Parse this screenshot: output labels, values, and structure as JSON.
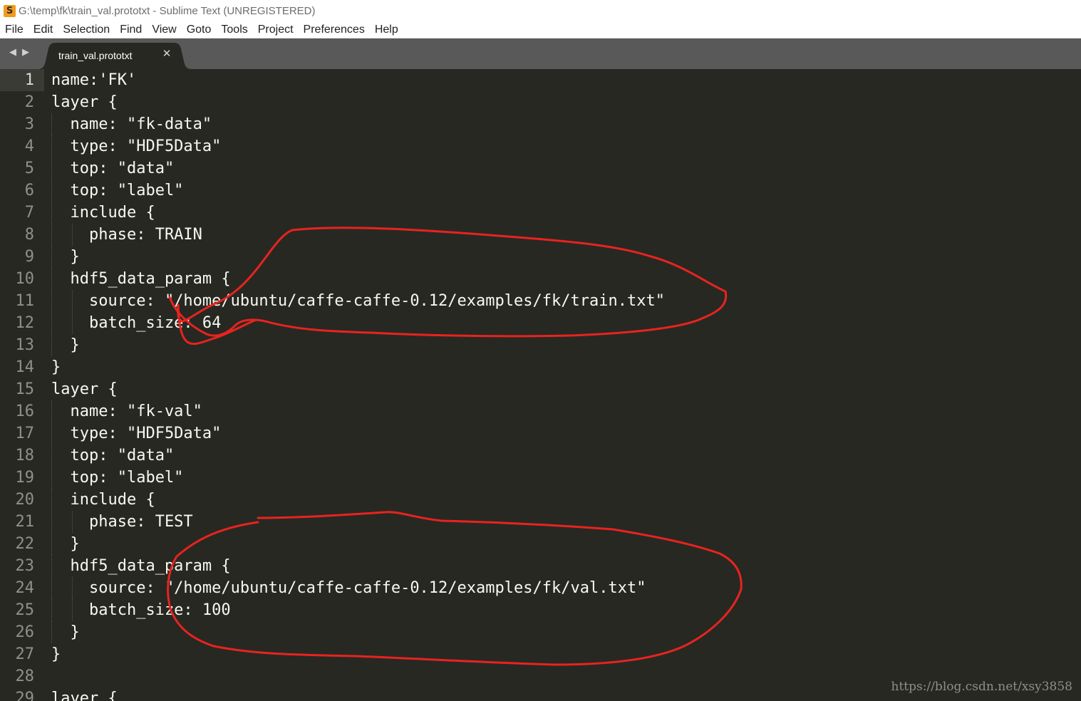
{
  "window": {
    "title": "G:\\temp\\fk\\train_val.prototxt - Sublime Text (UNREGISTERED)",
    "app_icon_glyph": "S",
    "app_icon_name": "sublime-text-icon"
  },
  "menu": {
    "items": [
      "File",
      "Edit",
      "Selection",
      "Find",
      "View",
      "Goto",
      "Tools",
      "Project",
      "Preferences",
      "Help"
    ]
  },
  "tabs": {
    "nav_prev_glyph": "◀",
    "nav_next_glyph": "▶",
    "active": {
      "title": "train_val.prototxt",
      "close_glyph": "✕"
    }
  },
  "editor": {
    "current_line": 1,
    "lines": [
      {
        "number": "1",
        "text": "name:'FK'"
      },
      {
        "number": "2",
        "text": "layer {"
      },
      {
        "number": "3",
        "text": "  name: \"fk-data\""
      },
      {
        "number": "4",
        "text": "  type: \"HDF5Data\""
      },
      {
        "number": "5",
        "text": "  top: \"data\""
      },
      {
        "number": "6",
        "text": "  top: \"label\""
      },
      {
        "number": "7",
        "text": "  include {"
      },
      {
        "number": "8",
        "text": "    phase: TRAIN"
      },
      {
        "number": "9",
        "text": "  }"
      },
      {
        "number": "10",
        "text": "  hdf5_data_param {"
      },
      {
        "number": "11",
        "text": "    source: \"/home/ubuntu/caffe-caffe-0.12/examples/fk/train.txt\""
      },
      {
        "number": "12",
        "text": "    batch_size: 64"
      },
      {
        "number": "13",
        "text": "  }"
      },
      {
        "number": "14",
        "text": "}"
      },
      {
        "number": "15",
        "text": "layer {"
      },
      {
        "number": "16",
        "text": "  name: \"fk-val\""
      },
      {
        "number": "17",
        "text": "  type: \"HDF5Data\""
      },
      {
        "number": "18",
        "text": "  top: \"data\""
      },
      {
        "number": "19",
        "text": "  top: \"label\""
      },
      {
        "number": "20",
        "text": "  include {"
      },
      {
        "number": "21",
        "text": "    phase: TEST"
      },
      {
        "number": "22",
        "text": "  }"
      },
      {
        "number": "23",
        "text": "  hdf5_data_param {"
      },
      {
        "number": "24",
        "text": "    source: \"/home/ubuntu/caffe-caffe-0.12/examples/fk/val.txt\""
      },
      {
        "number": "25",
        "text": "    batch_size: 100"
      },
      {
        "number": "26",
        "text": "  }"
      },
      {
        "number": "27",
        "text": "}"
      },
      {
        "number": "28",
        "text": ""
      },
      {
        "number": "29",
        "text": "layer {"
      }
    ]
  },
  "annotation_color": "#e8231f",
  "watermark": "https://blog.csdn.net/xsy3858",
  "colors": {
    "editor_bg": "#272822",
    "tabbar_bg": "#595959",
    "text": "#f8f8f2",
    "gutter_text": "#8f908a"
  }
}
